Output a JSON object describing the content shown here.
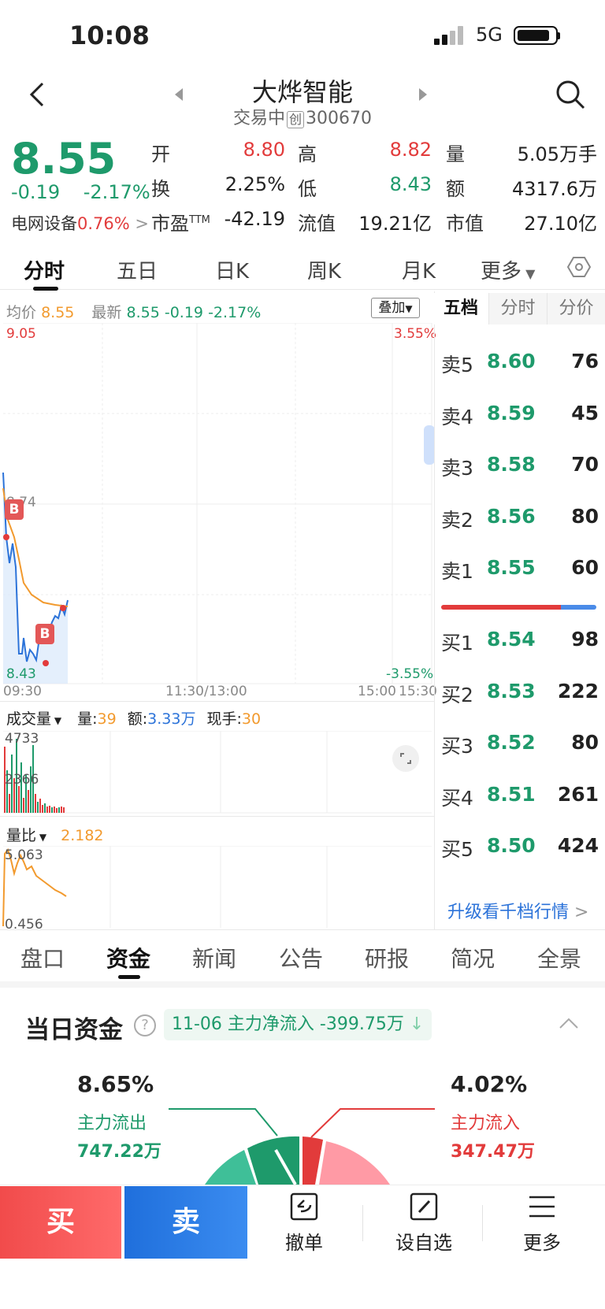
{
  "status": {
    "time": "10:08",
    "network": "5G"
  },
  "header": {
    "stock_name": "大烨智能",
    "status_text": "交易中",
    "board_tag": "创",
    "code": "300670"
  },
  "quote": {
    "price": "8.55",
    "change": "-0.19",
    "change_pct": "-2.17%",
    "sector": "电网设备",
    "sector_pct": "0.76%",
    "rows": [
      [
        {
          "label": "开",
          "value": "8.80",
          "color": "#e23b3b"
        },
        {
          "label": "高",
          "value": "8.82",
          "color": "#e23b3b"
        },
        {
          "label": "量",
          "value": "5.05万手",
          "color": "#222222"
        }
      ],
      [
        {
          "label": "换",
          "value": "2.25%",
          "color": "#222222"
        },
        {
          "label": "低",
          "value": "8.43",
          "color": "#1e9a6b"
        },
        {
          "label": "额",
          "value": "4317.6万",
          "color": "#222222"
        }
      ],
      [
        {
          "label": "市盈TTM",
          "value": "-42.19",
          "color": "#222222"
        },
        {
          "label": "流值",
          "value": "19.21亿",
          "color": "#222222"
        },
        {
          "label": "市值",
          "value": "27.10亿",
          "color": "#222222"
        }
      ]
    ]
  },
  "tabs": {
    "items": [
      "分时",
      "五日",
      "日K",
      "周K",
      "月K",
      "更多"
    ],
    "active": "分时"
  },
  "chart": {
    "avg_label": "均价",
    "avg_value": "8.55",
    "latest_label": "最新",
    "latest_value": "8.55",
    "latest_change": "-0.19",
    "latest_pct": "-2.17%",
    "overlay_label": "叠加",
    "y_high": "9.05",
    "y_mid": "8.74",
    "y_low": "8.43",
    "pct_high": "3.55%",
    "pct_low": "-3.55%",
    "x_start": "09:30",
    "x_mid": "11:30/13:00",
    "x_end1": "15:00",
    "x_end2": "15:30",
    "badge": "B",
    "volume_label": "成交量",
    "vol_key": "量:",
    "vol_val": "39",
    "amt_key": "额:",
    "amt_val": "3.33万",
    "cur_key": "现手:",
    "cur_val": "30",
    "vol_top": "4733",
    "vol_mid": "2366",
    "ratio_label": "量比",
    "ratio_val": "2.182",
    "ratio_top": "5.063",
    "ratio_bottom": "0.456"
  },
  "orderbook": {
    "tabs": [
      "五档",
      "分时",
      "分价"
    ],
    "asks": [
      {
        "label": "卖5",
        "price": "8.60",
        "vol": "76"
      },
      {
        "label": "卖4",
        "price": "8.59",
        "vol": "45"
      },
      {
        "label": "卖3",
        "price": "8.58",
        "vol": "70"
      },
      {
        "label": "卖2",
        "price": "8.56",
        "vol": "80"
      },
      {
        "label": "卖1",
        "price": "8.55",
        "vol": "60"
      }
    ],
    "bids": [
      {
        "label": "买1",
        "price": "8.54",
        "vol": "98"
      },
      {
        "label": "买2",
        "price": "8.53",
        "vol": "222"
      },
      {
        "label": "买3",
        "price": "8.52",
        "vol": "80"
      },
      {
        "label": "买4",
        "price": "8.51",
        "vol": "261"
      },
      {
        "label": "买5",
        "price": "8.50",
        "vol": "424"
      }
    ],
    "upgrade": "升级看千档行情"
  },
  "info_tabs": {
    "items": [
      "盘口",
      "资金",
      "新闻",
      "公告",
      "研报",
      "简况",
      "全景"
    ],
    "active": "资金"
  },
  "funds": {
    "title": "当日资金",
    "pill": "11-06 主力净流入 -399.75万",
    "out_pct": "8.65%",
    "out_label": "主力流出",
    "out_value": "747.22万",
    "in_pct": "4.02%",
    "in_label": "主力流入",
    "in_value": "347.47万"
  },
  "bottom": {
    "buy": "买",
    "sell": "卖",
    "cancel": "撤单",
    "watchlist": "设自选",
    "more": "更多"
  }
}
